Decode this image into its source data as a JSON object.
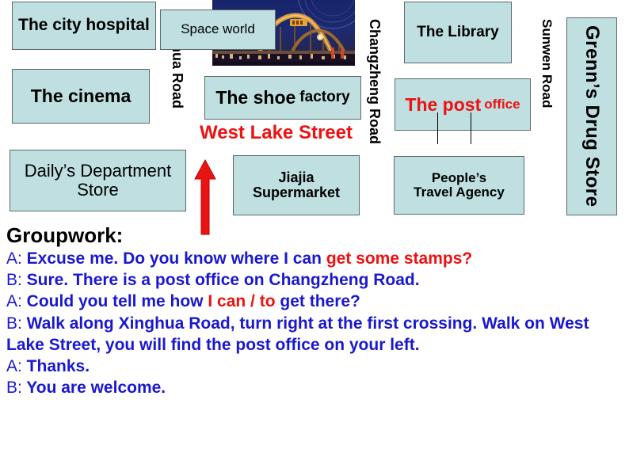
{
  "slide": {
    "title": "Groupwork:"
  },
  "map": {
    "buildings": [
      {
        "name": "the-city-hospital",
        "label": "The city hospital"
      },
      {
        "name": "the-cinema",
        "label": "The cinema"
      },
      {
        "name": "dailys-department-store",
        "label": "Daily’s Department Store"
      },
      {
        "name": "space-world",
        "label": "Space world"
      },
      {
        "name": "the-shoe-factory",
        "label_big": "The shoe",
        "label_small": "factory"
      },
      {
        "name": "jiajia-supermarket",
        "label_line1": "Jiajia",
        "label_line2": "Supermarket"
      },
      {
        "name": "the-library",
        "label": "The Library"
      },
      {
        "name": "the-post-office",
        "label_big": "The post",
        "label_small": "office"
      },
      {
        "name": "peoples-travel-agency",
        "label_line1": "People’s",
        "label_line2": "Travel Agency"
      },
      {
        "name": "grenns-drug-store",
        "label": "Grenn’s Drug Store"
      }
    ],
    "roads": {
      "xinghua": "Xinghua Road",
      "changzheng": "Changzheng Road",
      "sunwen": "Sunwen Road"
    },
    "street_label": "West Lake Street",
    "photo_alt": "space-world-night-photo"
  },
  "dialogue": {
    "lines": [
      {
        "speaker": "A:",
        "parts": [
          {
            "text": " Excuse me. Do you know where I can ",
            "highlight": false
          },
          {
            "text": "get some stamps?",
            "highlight": true
          }
        ]
      },
      {
        "speaker": "B:",
        "parts": [
          {
            "text": " Sure. There is a post office on Changzheng Road.",
            "highlight": false
          }
        ]
      },
      {
        "speaker": "A:",
        "parts": [
          {
            "text": " Could you tell me how ",
            "highlight": false
          },
          {
            "text": "I can / to ",
            "highlight": true
          },
          {
            "text": "get there?",
            "highlight": false
          }
        ]
      },
      {
        "speaker": "B:",
        "parts": [
          {
            "text": " Walk along Xinghua Road, turn right at the first crossing. Walk on West Lake Street, you will find the post office on your left.",
            "highlight": false
          }
        ]
      },
      {
        "speaker": "A:",
        "parts": [
          {
            "text": " Thanks.",
            "highlight": false
          }
        ]
      },
      {
        "speaker": "B:",
        "parts": [
          {
            "text": " You are welcome.",
            "highlight": false
          }
        ]
      }
    ]
  },
  "colors": {
    "box_fill": "#bfdfe0",
    "box_border": "#5a6a6b",
    "highlight_red": "#ee1111",
    "dialogue_blue": "#1a18cf",
    "arrow_red": "#e81313"
  }
}
